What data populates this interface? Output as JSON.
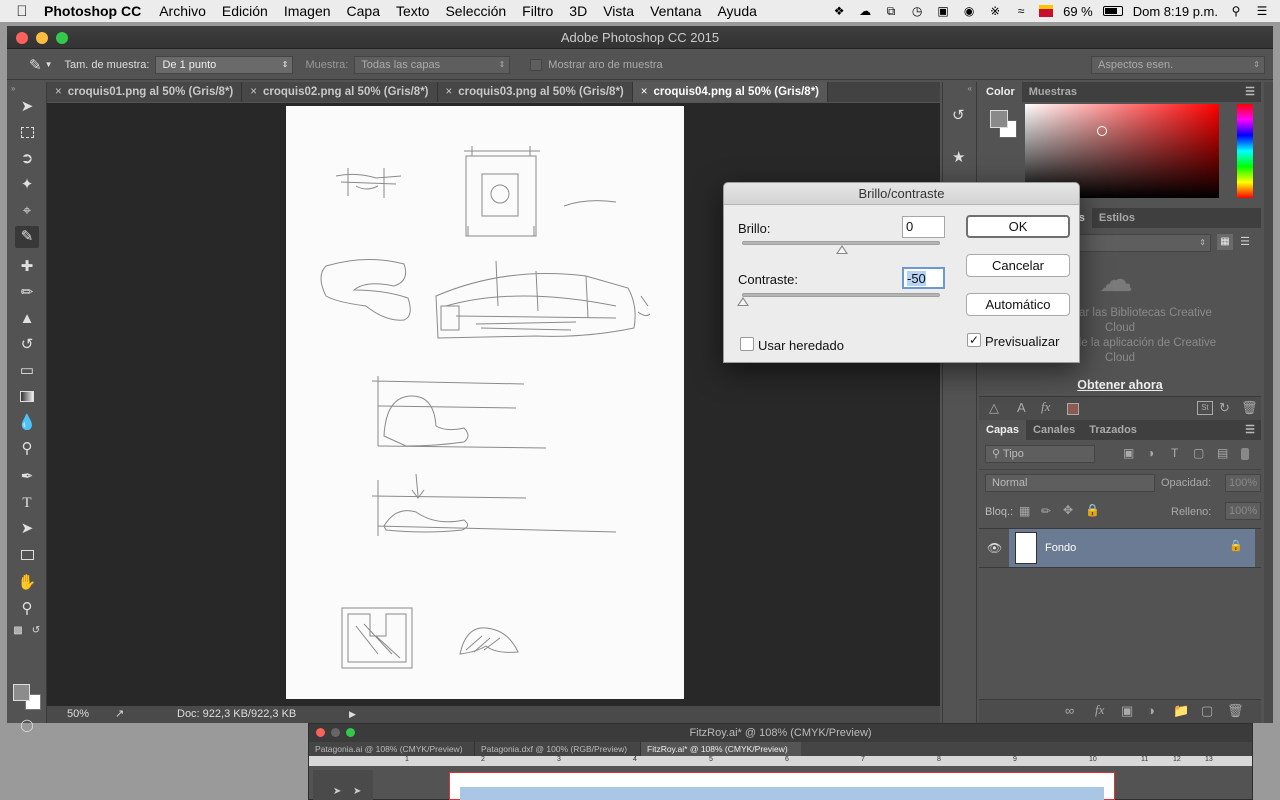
{
  "menubar": {
    "app": "Photoshop CC",
    "items": [
      "Archivo",
      "Edición",
      "Imagen",
      "Capa",
      "Texto",
      "Selección",
      "Filtro",
      "3D",
      "Vista",
      "Ventana",
      "Ayuda"
    ],
    "battery": "69 %",
    "clock": "Dom 8:19 p.m."
  },
  "window": {
    "title": "Adobe Photoshop CC 2015"
  },
  "options": {
    "sample_size_label": "Tam. de muestra:",
    "sample_size_value": "De 1 punto",
    "sample_label": "Muestra:",
    "sample_value": "Todas las capas",
    "show_ring_label": "Mostrar aro de muestra",
    "workspace": "Aspectos esen."
  },
  "doc_tabs": [
    "croquis01.png al 50% (Gris/8*)",
    "croquis02.png al 50% (Gris/8*)",
    "croquis03.png al 50% (Gris/8*)",
    "croquis04.png al 50% (Gris/8*)"
  ],
  "status": {
    "zoom": "50%",
    "doc": "Doc: 922,3 KB/922,3 KB"
  },
  "color_panel": {
    "tabs": [
      "Color",
      "Muestras"
    ],
    "fg_color": "#8a8a8a",
    "bg_color": "#ffffff"
  },
  "libraries_panel": {
    "tabs": [
      "tes",
      "Estilos"
    ],
    "message1": "ar las Bibliotecas Creative",
    "message2": "Cloud",
    "message3": "Instale la aplicación de Creative",
    "message4": "Cloud",
    "cta": "Obtener ahora"
  },
  "layers_panel": {
    "tabs": [
      "Capas",
      "Canales",
      "Trazados"
    ],
    "filter": "Tipo",
    "blend": "Normal",
    "opacity_label": "Opacidad:",
    "opacity": "100%",
    "lock_label": "Bloq.:",
    "fill_label": "Relleno:",
    "fill": "100%",
    "layers": [
      {
        "name": "Fondo",
        "visible": true,
        "locked": true
      }
    ]
  },
  "dialog": {
    "title": "Brillo/contraste",
    "brightness_label": "Brillo:",
    "brightness_value": "0",
    "contrast_label": "Contraste:",
    "contrast_value": "-50",
    "legacy_label": "Usar heredado",
    "legacy_checked": false,
    "ok": "OK",
    "cancel": "Cancelar",
    "auto": "Automático",
    "preview_label": "Previsualizar",
    "preview_checked": true
  },
  "bg_app": {
    "title": "FitzRoy.ai* @ 108% (CMYK/Preview)",
    "tabs": [
      "Patagonia.ai @ 108% (CMYK/Preview)",
      "Patagonia.dxf @ 100% (RGB/Preview)",
      "FitzRoy.ai* @ 108% (CMYK/Preview)"
    ],
    "ruler": [
      "1",
      "2",
      "3",
      "4",
      "5",
      "6",
      "7",
      "8",
      "9",
      "10",
      "11",
      "12",
      "13"
    ]
  }
}
